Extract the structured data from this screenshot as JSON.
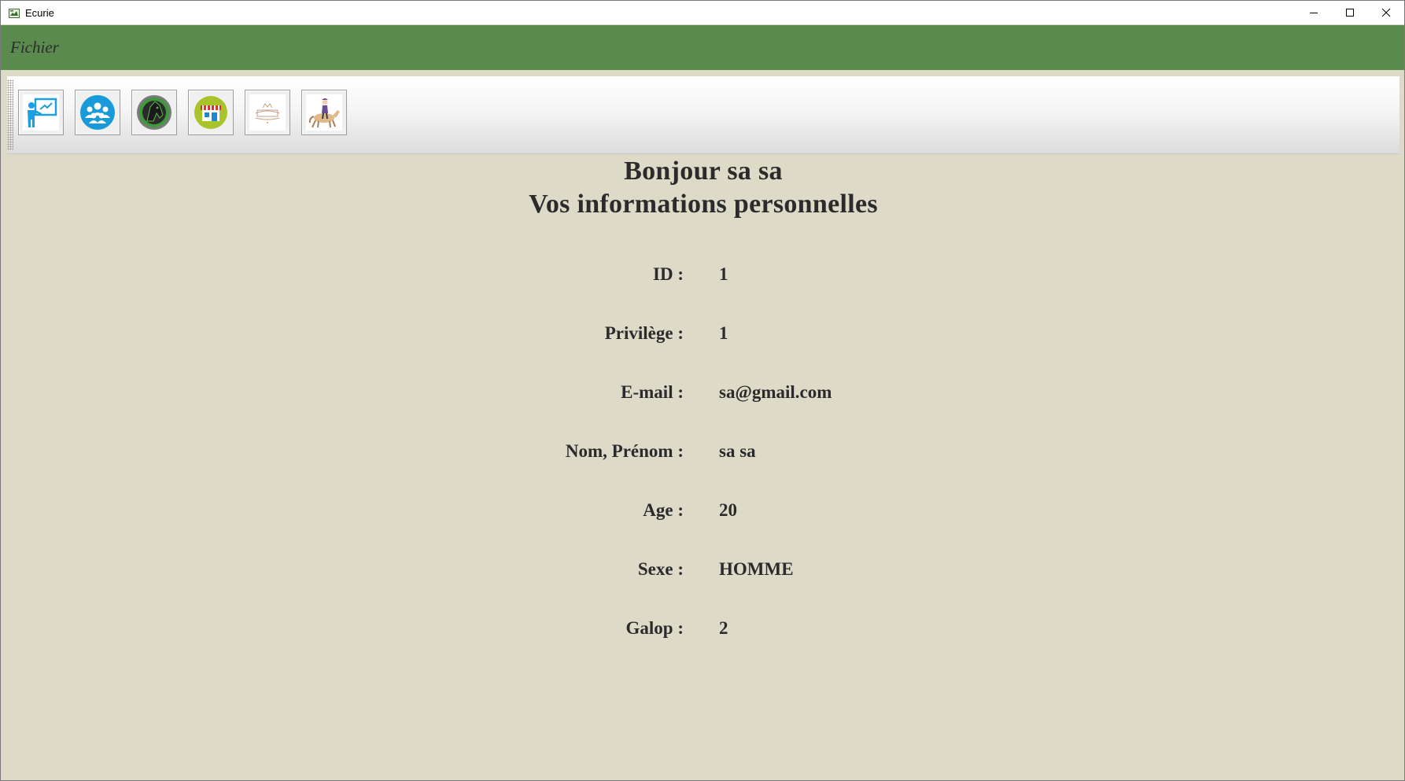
{
  "window": {
    "title": "Ecurie"
  },
  "menu": {
    "items": [
      "Fichier"
    ]
  },
  "toolbar": {
    "buttons": [
      {
        "icon": "teacher-board-icon"
      },
      {
        "icon": "group-users-icon"
      },
      {
        "icon": "horse-head-icon"
      },
      {
        "icon": "shop-store-icon"
      },
      {
        "icon": "event-logo-icon"
      },
      {
        "icon": "rider-on-horse-icon"
      }
    ]
  },
  "content": {
    "greeting_line": "Bonjour  sa sa",
    "subtitle": "Vos informations personnelles",
    "fields": [
      {
        "label": "ID :",
        "value": "1"
      },
      {
        "label": "Privilège :",
        "value": "1"
      },
      {
        "label": "E-mail :",
        "value": "sa@gmail.com"
      },
      {
        "label": "Nom, Prénom :",
        "value": "sa sa"
      },
      {
        "label": "Age :",
        "value": "20"
      },
      {
        "label": "Sexe :",
        "value": "HOMME"
      },
      {
        "label": "Galop :",
        "value": "2"
      }
    ]
  },
  "colors": {
    "menubar": "#5a8a4e",
    "background": "#dddbc8",
    "text": "#2b2b2b"
  }
}
